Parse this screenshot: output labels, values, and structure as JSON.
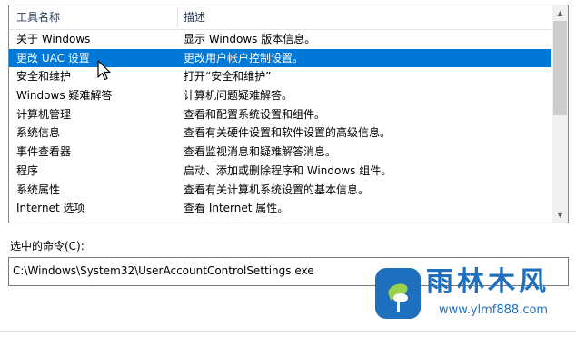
{
  "list": {
    "header": {
      "col1": "工具名称",
      "col2": "描述"
    },
    "selected_index": 1,
    "rows": [
      {
        "name": "关于 Windows",
        "desc": "显示 Windows 版本信息。"
      },
      {
        "name": "更改 UAC 设置",
        "desc": "更改用户帐户控制设置。"
      },
      {
        "name": "安全和维护",
        "desc": "打开“安全和维护”"
      },
      {
        "name": "Windows 疑难解答",
        "desc": "计算机问题疑难解答。"
      },
      {
        "name": "计算机管理",
        "desc": "查看和配置系统设置和组件。"
      },
      {
        "name": "系统信息",
        "desc": "查看有关硬件设置和软件设置的高级信息。"
      },
      {
        "name": "事件查看器",
        "desc": "查看监视消息和疑难解答消息。"
      },
      {
        "name": "程序",
        "desc": "启动、添加或删除程序和 Windows 组件。"
      },
      {
        "name": "系统属性",
        "desc": "查看有关计算机系统设置的基本信息。"
      },
      {
        "name": "Internet 选项",
        "desc": "查看 Internet 属性。"
      }
    ]
  },
  "command": {
    "label": "选中的命令(C):",
    "value": "C:\\Windows\\System32\\UserAccountControlSettings.exe"
  },
  "watermark": {
    "title": "雨林木风",
    "url": "www.ylmf888.com"
  },
  "colors": {
    "selection": "#0078d7",
    "watermark": "#1f6fbf"
  },
  "icons": [
    "scroll-up-arrow-icon",
    "scroll-down-arrow-icon",
    "mouse-cursor-icon",
    "rain-forest-logo-icon"
  ]
}
